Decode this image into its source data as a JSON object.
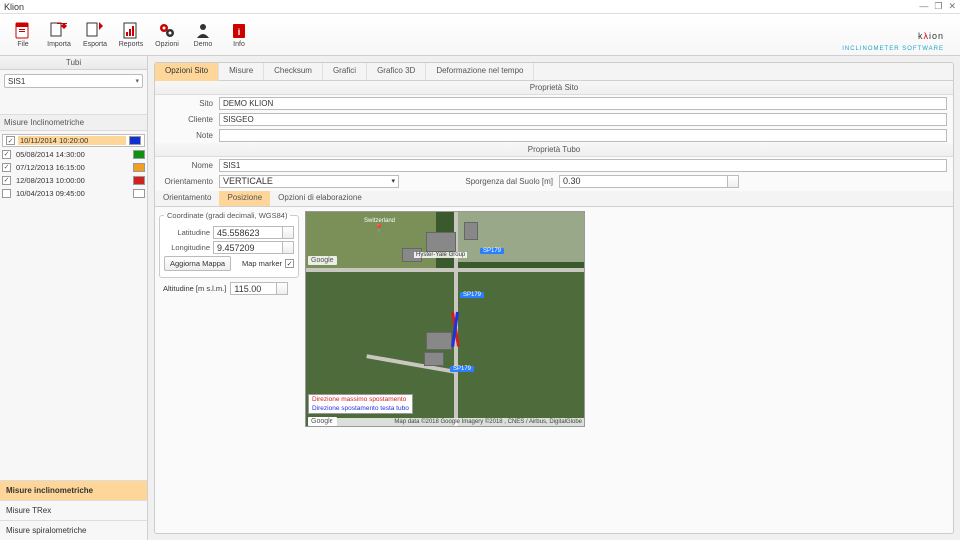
{
  "window": {
    "title": "Klion"
  },
  "logo": {
    "brand_main": "k",
    "brand_accent": "λ",
    "brand_rest": "ion",
    "subtitle": "INCLINOMETER SOFTWARE"
  },
  "toolbar": [
    {
      "label": "File"
    },
    {
      "label": "Importa"
    },
    {
      "label": "Esporta"
    },
    {
      "label": "Reports"
    },
    {
      "label": "Opzioni"
    },
    {
      "label": "Demo"
    },
    {
      "label": "Info"
    }
  ],
  "side": {
    "tubi_header": "Tubi",
    "tube_selected": "SIS1",
    "meas_header": "Misure Inclinometriche",
    "measures": [
      {
        "dt": "10/11/2014 10:20:00",
        "color": "#1030d0",
        "checked": true,
        "sel": true
      },
      {
        "dt": "05/08/2014 14:30:00",
        "color": "#109010",
        "checked": true,
        "sel": false
      },
      {
        "dt": "07/12/2013 16:15:00",
        "color": "#f0a020",
        "checked": true,
        "sel": false
      },
      {
        "dt": "12/08/2013 10:00:00",
        "color": "#d02020",
        "checked": true,
        "sel": false
      },
      {
        "dt": "10/04/2013 09:45:00",
        "color": "#ffffff",
        "checked": false,
        "sel": false
      }
    ],
    "nav": [
      {
        "label": "Misure inclinometriche",
        "active": true
      },
      {
        "label": "Misure TRex",
        "active": false
      },
      {
        "label": "Misure spiralometriche",
        "active": false
      }
    ]
  },
  "tabs": [
    {
      "label": "Opzioni Sito",
      "active": true
    },
    {
      "label": "Misure",
      "active": false
    },
    {
      "label": "Checksum",
      "active": false
    },
    {
      "label": "Grafici",
      "active": false
    },
    {
      "label": "Grafico 3D",
      "active": false
    },
    {
      "label": "Deformazione nel tempo",
      "active": false
    }
  ],
  "site": {
    "header": "Proprietà Sito",
    "sito_label": "Sito",
    "sito_val": "DEMO KLION",
    "cliente_label": "Cliente",
    "cliente_val": "SISGEO",
    "note_label": "Note",
    "note_val": ""
  },
  "tubo": {
    "header": "Proprietà Tubo",
    "nome_label": "Nome",
    "nome_val": "SIS1",
    "orient_label": "Orientamento",
    "orient_val": "VERTICALE",
    "sporg_label": "Sporgenza dal Suolo [m]",
    "sporg_val": "0.30"
  },
  "subtabs": [
    {
      "label": "Orientamento",
      "active": false
    },
    {
      "label": "Posizione",
      "active": true
    },
    {
      "label": "Opzioni di elaborazione",
      "active": false
    }
  ],
  "coord": {
    "legend": "Coordinate (gradi decimali, WGS84)",
    "lat_label": "Latitudine",
    "lat_val": "45.558623",
    "lon_label": "Longitudine",
    "lon_val": "9.457209",
    "upd_btn": "Aggiorna Mappa",
    "marker_label": "Map marker",
    "marker_checked": true
  },
  "alt": {
    "label": "Altitudine [m s.l.m.]",
    "val": "115.00"
  },
  "map": {
    "legend_red": "Direzione massimo spostamento",
    "legend_blue": "Direzione spostamento testa tubo",
    "attrib": "Map data ©2018 Google  Imagery ©2018 , CNES / Airbus, DigitalGlobe",
    "google": "Google",
    "sign": "SP179",
    "place": "Hyster-Yale Group"
  }
}
